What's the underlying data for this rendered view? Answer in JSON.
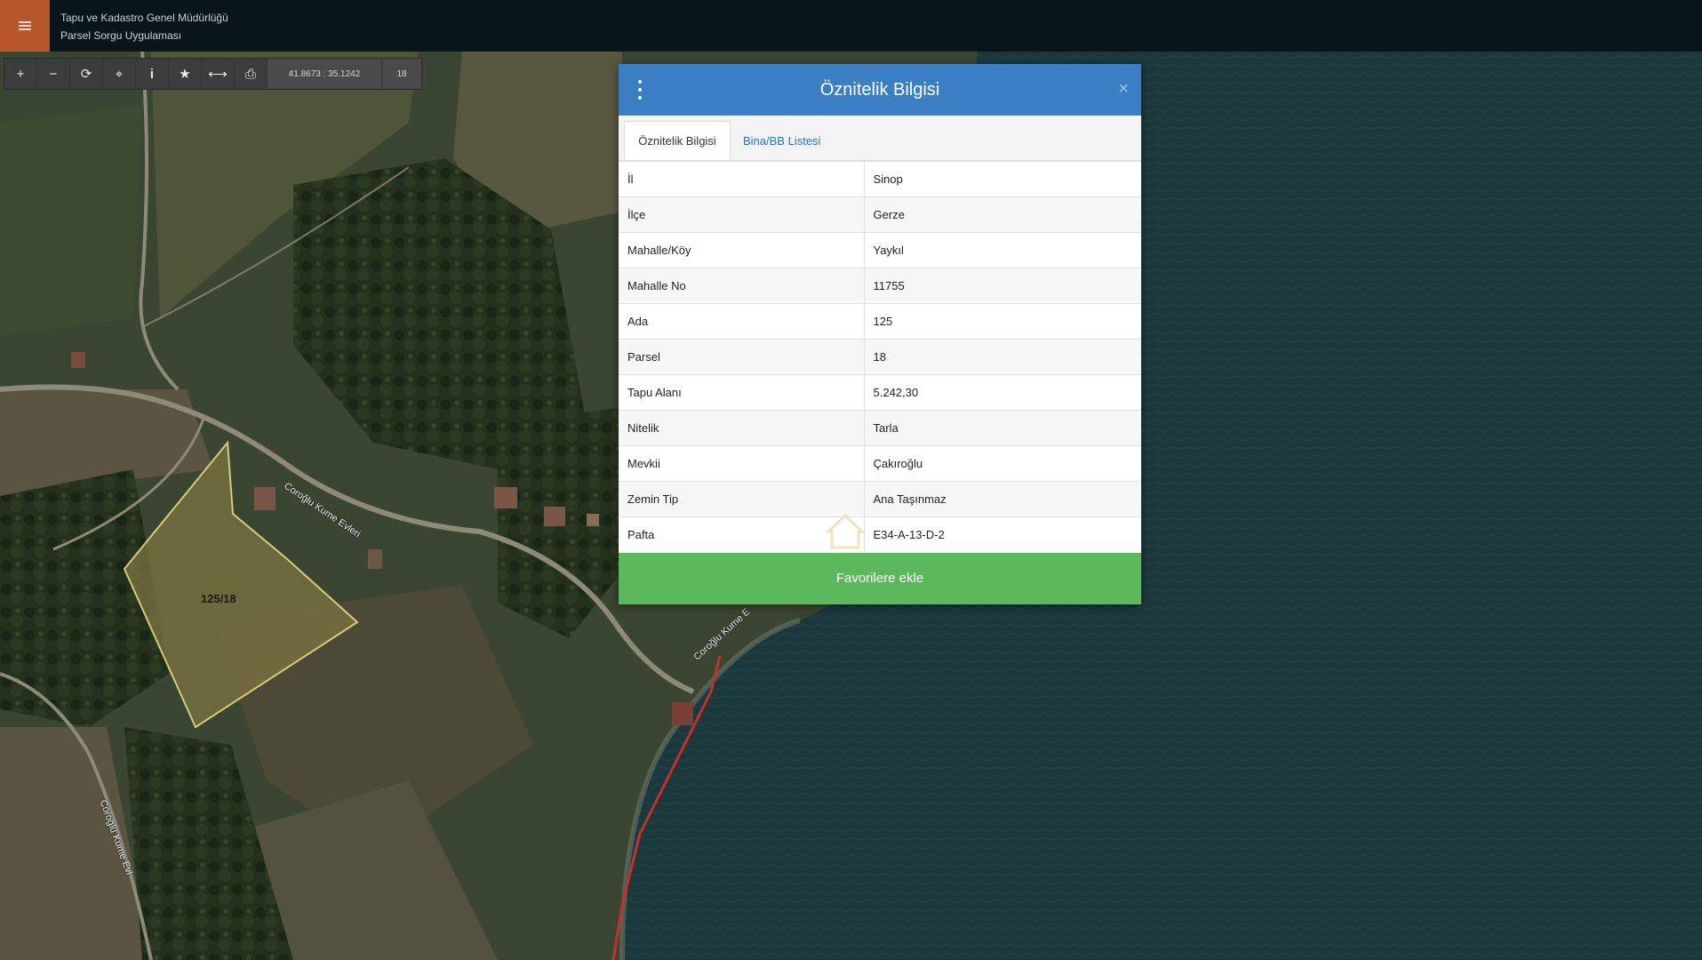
{
  "header": {
    "org_name": "Tapu ve Kadastro Genel Müdürlüğü",
    "app_name": "Parsel Sorgu Uygulaması",
    "accent_color": "#b8562b"
  },
  "toolbar": {
    "tools": [
      {
        "name": "zoom-in-icon",
        "glyph": "+"
      },
      {
        "name": "zoom-out-icon",
        "glyph": "−"
      },
      {
        "name": "refresh-icon",
        "glyph": "⟳"
      },
      {
        "name": "locate-icon",
        "glyph": "⌖"
      },
      {
        "name": "info-icon",
        "glyph": "i"
      },
      {
        "name": "star-icon",
        "glyph": "★"
      },
      {
        "name": "measure-icon",
        "glyph": "⟷"
      },
      {
        "name": "print-icon",
        "glyph": "⎙"
      }
    ],
    "coordinates": "41.8673 : 35.1242",
    "zoom_level": "18"
  },
  "map": {
    "parcel_label": "125/18",
    "road_labels": [
      "Coroğlu Kume Evleri",
      "Coroğlu Kume E",
      "Coroğlu Kume Evl"
    ]
  },
  "dialog": {
    "title": "Öznitelik Bilgisi",
    "header_color": "#3a7fc3",
    "tabs": [
      {
        "label": "Öznitelik Bilgisi",
        "active": true
      },
      {
        "label": "Bina/BB Listesi",
        "active": false
      }
    ],
    "rows": [
      {
        "key": "İl",
        "value": "Sinop"
      },
      {
        "key": "İlçe",
        "value": "Gerze"
      },
      {
        "key": "Mahalle/Köy",
        "value": "Yaykıl"
      },
      {
        "key": "Mahalle No",
        "value": "11755"
      },
      {
        "key": "Ada",
        "value": "125"
      },
      {
        "key": "Parsel",
        "value": "18"
      },
      {
        "key": "Tapu Alanı",
        "value": "5.242,30"
      },
      {
        "key": "Nitelik",
        "value": "Tarla"
      },
      {
        "key": "Mevkii",
        "value": "Çakıroğlu"
      },
      {
        "key": "Zemin Tip",
        "value": "Ana Taşınmaz"
      },
      {
        "key": "Pafta",
        "value": "E34-A-13-D-2"
      }
    ],
    "favorite_button": "Favorilere ekle",
    "favorite_color": "#5cb85c"
  }
}
